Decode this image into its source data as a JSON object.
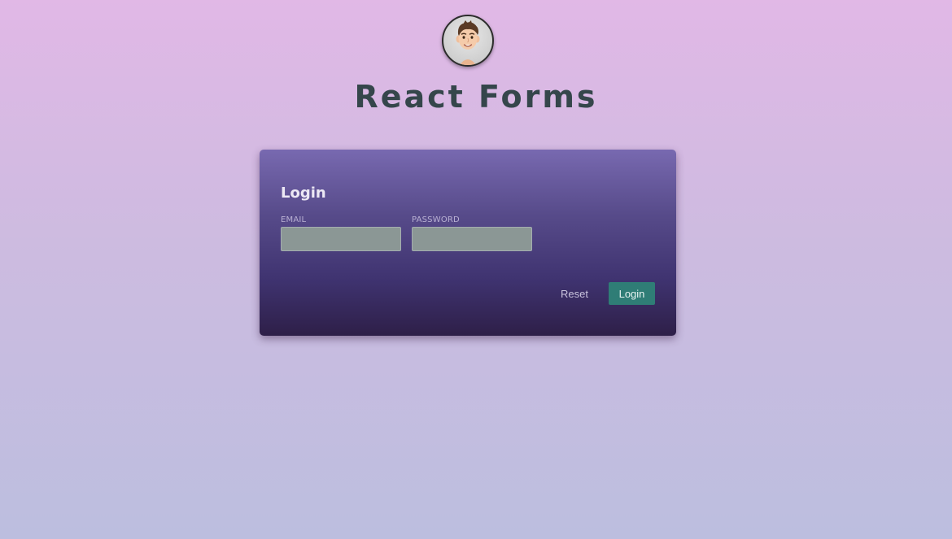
{
  "header": {
    "avatar_icon": "memoji-avatar-icon",
    "title": "React Forms"
  },
  "login_form": {
    "heading": "Login",
    "email": {
      "label": "EMAIL",
      "value": "",
      "placeholder": ""
    },
    "password": {
      "label": "PASSWORD",
      "value": "",
      "placeholder": ""
    },
    "reset_label": "Reset",
    "submit_label": "Login"
  },
  "colors": {
    "page_gradient_top": "#e1b8e6",
    "page_gradient_bottom": "#bcbedf",
    "card_gradient_top": "#7869b0",
    "card_gradient_bottom": "#2e1f48",
    "title_text": "#35464b",
    "input_background": "#8b9795",
    "primary_button": "#2f7d76"
  }
}
